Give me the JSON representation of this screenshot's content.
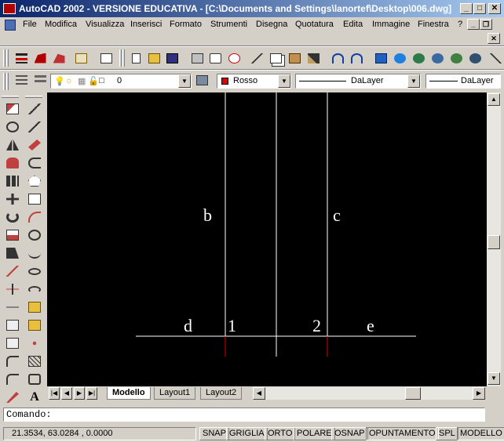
{
  "window": {
    "title": "AutoCAD 2002 - VERSIONE EDUCATIVA - [C:\\Documents and Settings\\lanortef\\Desktop\\006.dwg]",
    "min_label": "_",
    "max_label": "□",
    "close_label": "✕"
  },
  "menubar": {
    "items": [
      {
        "label": "File"
      },
      {
        "label": "Modifica"
      },
      {
        "label": "Visualizza"
      },
      {
        "label": "Inserisci"
      },
      {
        "label": "Formato"
      },
      {
        "label": "Strumenti"
      },
      {
        "label": "Disegna"
      },
      {
        "label": "Quotatura"
      },
      {
        "label": "Edita"
      },
      {
        "label": "Immagine"
      },
      {
        "label": "Finestra"
      },
      {
        "label": "?"
      }
    ],
    "mdi_min": "_",
    "mdi_restore": "❐",
    "mdi_close": "✕"
  },
  "toolbar": {
    "icons": [
      "new-icon",
      "open-icon",
      "save-icon",
      "print-icon",
      "print-preview-icon",
      "spell-check-icon",
      "cut-icon",
      "copy-icon",
      "paste-icon",
      "match-properties-icon",
      "undo-icon",
      "redo-icon",
      "aerial-view-icon",
      "autodesk-point-a-icon",
      "web-browse-icon",
      "web-publish-icon",
      "web-link-icon",
      "pan-icon"
    ]
  },
  "properties": {
    "layer_value": "0",
    "color_value": "Rosso",
    "color_hex": "#e00000",
    "linetype_value": "DaLayer",
    "lineweight_value": "DaLayer"
  },
  "drawing": {
    "labels": [
      "b",
      "c",
      "d",
      "1",
      "2",
      "e"
    ],
    "line_color": "#ffffff",
    "accent_line_color": "#e00000"
  },
  "tabs": [
    {
      "label": "Modello",
      "active": true
    },
    {
      "label": "Layout1",
      "active": false
    },
    {
      "label": "Layout2",
      "active": false
    }
  ],
  "command": {
    "prompt": "Comando:"
  },
  "status": {
    "coordinates": "21.3534,  63.0284 , 0.0000",
    "buttons": [
      {
        "label": "SNAP",
        "on": false
      },
      {
        "label": "GRIGLIA",
        "on": false
      },
      {
        "label": "ORTO",
        "on": false
      },
      {
        "label": "POLARE",
        "on": false
      },
      {
        "label": "OSNAP",
        "on": false
      },
      {
        "label": "OPUNTAMENTO",
        "on": true
      },
      {
        "label": "SPL",
        "on": false
      },
      {
        "label": "MODELLO",
        "on": true
      }
    ]
  }
}
